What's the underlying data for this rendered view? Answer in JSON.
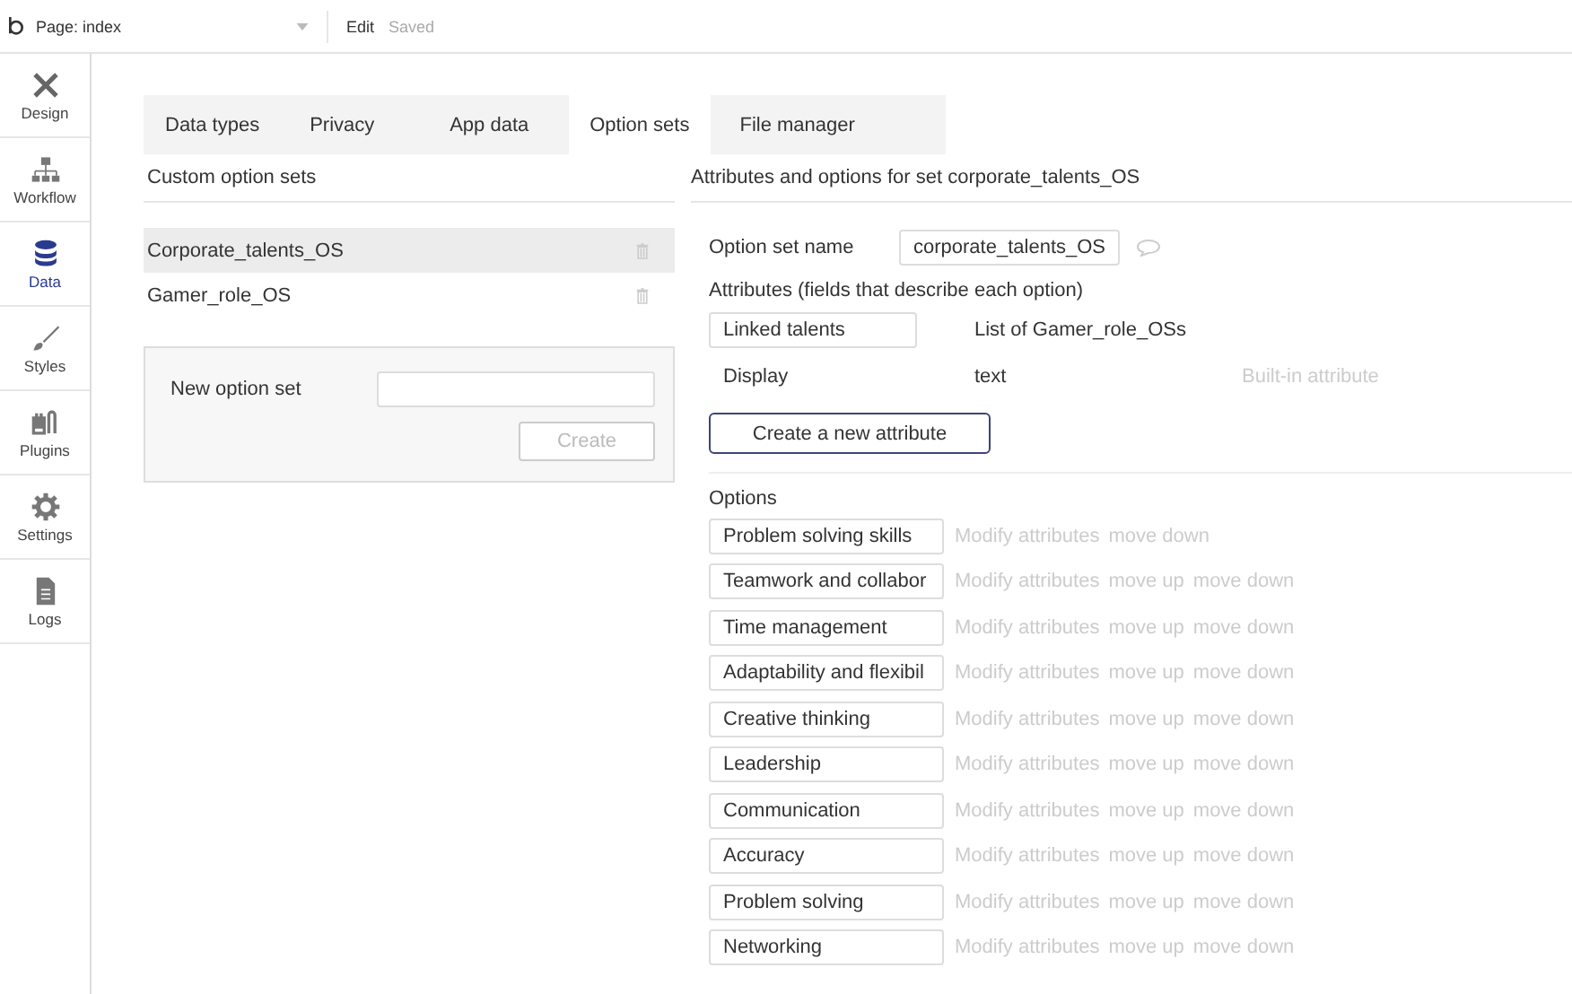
{
  "topbar": {
    "page_label": "Page: index",
    "edit": "Edit",
    "status": "Saved"
  },
  "sidebar": {
    "items": [
      {
        "label": "Design",
        "kind": "design",
        "selected": false
      },
      {
        "label": "Workflow",
        "kind": "workflow",
        "selected": false
      },
      {
        "label": "Data",
        "kind": "data",
        "selected": true
      },
      {
        "label": "Styles",
        "kind": "styles",
        "selected": false
      },
      {
        "label": "Plugins",
        "kind": "plugins",
        "selected": false
      },
      {
        "label": "Settings",
        "kind": "settings",
        "selected": false
      },
      {
        "label": "Logs",
        "kind": "logs",
        "selected": false
      }
    ]
  },
  "tabs": [
    {
      "label": "Data types",
      "selected": false
    },
    {
      "label": "Privacy",
      "selected": false
    },
    {
      "label": "App data",
      "selected": false
    },
    {
      "label": "Option sets",
      "selected": true
    },
    {
      "label": "File manager",
      "selected": false
    }
  ],
  "option_sets": {
    "title": "Custom option sets",
    "items": [
      {
        "name": "Corporate_talents_OS",
        "selected": true
      },
      {
        "name": "Gamer_role_OS",
        "selected": false
      }
    ],
    "new_set": {
      "label": "New option set",
      "button": "Create"
    }
  },
  "detail": {
    "title": "Attributes and options for set corporate_talents_OS",
    "name_label": "Option set name",
    "name_value": "corporate_talents_OS",
    "attributes_label": "Attributes (fields that describe each option)",
    "attributes": [
      {
        "name": "Linked talents",
        "type": "List of Gamer_role_OSs",
        "kind": "editable"
      },
      {
        "name": "Display",
        "type": "text",
        "note": "Built-in attribute",
        "kind": "builtin"
      }
    ],
    "create_button": "Create a new attribute",
    "options_label": "Options",
    "options": [
      {
        "value": "Problem solving skills",
        "actions": [
          "Modify attributes",
          "move down"
        ]
      },
      {
        "value": "Teamwork and collabor",
        "actions": [
          "Modify attributes",
          "move up",
          "move down"
        ]
      },
      {
        "value": "Time management",
        "actions": [
          "Modify attributes",
          "move up",
          "move down"
        ]
      },
      {
        "value": "Adaptability and flexibil",
        "actions": [
          "Modify attributes",
          "move up",
          "move down"
        ]
      },
      {
        "value": "Creative thinking",
        "actions": [
          "Modify attributes",
          "move up",
          "move down"
        ]
      },
      {
        "value": "Leadership",
        "actions": [
          "Modify attributes",
          "move up",
          "move down"
        ]
      },
      {
        "value": "Communication",
        "actions": [
          "Modify attributes",
          "move up",
          "move down"
        ]
      },
      {
        "value": "Accuracy",
        "actions": [
          "Modify attributes",
          "move up",
          "move down"
        ]
      },
      {
        "value": "Problem solving",
        "actions": [
          "Modify attributes",
          "move up",
          "move down"
        ]
      },
      {
        "value": "Networking",
        "actions": [
          "Modify attributes",
          "move up",
          "move down"
        ]
      }
    ]
  }
}
